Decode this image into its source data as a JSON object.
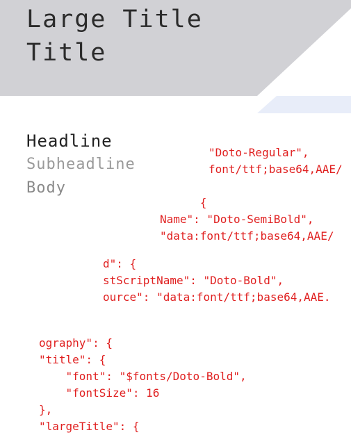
{
  "typography_preview": {
    "large_title": "Large Title",
    "title": "Title",
    "headline": "Headline",
    "subheadline": "Subheadline",
    "body": "Body"
  },
  "code_lines": {
    "block_a": [
      "\"Doto-Regular\",",
      "font/ttf;base64,AAE/"
    ],
    "block_b": [
      "      {",
      "Name\": \"Doto-SemiBold\",",
      "\"data:font/ttf;base64,AAE/"
    ],
    "block_c": [
      "d\": {",
      "stScriptName\": \"Doto-Bold\",",
      "ource\": \"data:font/ttf;base64,AAE."
    ],
    "block_d": [
      "ography\": {",
      "\"title\": {",
      "    \"font\": \"$fonts/Doto-Bold\",",
      "    \"fontSize\": 16",
      "},",
      "\"largeTitle\": {"
    ]
  },
  "colors": {
    "banner": "#d1d1d5",
    "code": "#e02020",
    "headline": "#222222",
    "subheadline": "#9a9a9a"
  }
}
